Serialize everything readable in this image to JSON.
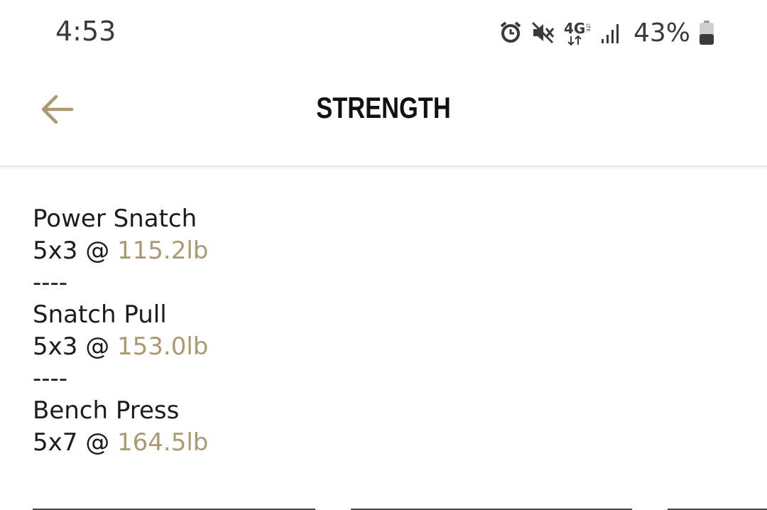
{
  "status_bar": {
    "time": "4:53",
    "battery_percent": "43%",
    "icons": [
      "alarm-icon",
      "mute-icon",
      "4g-lte-icon",
      "signal-icon",
      "battery-icon"
    ]
  },
  "app_bar": {
    "title": "STRENGTH",
    "back_icon": "arrow-left-icon"
  },
  "colors": {
    "accent": "#ab9971",
    "text": "#1c1c1c"
  },
  "workout": {
    "exercises": [
      {
        "name": "Power Snatch",
        "scheme": "5x3 @ ",
        "weight": "115.2lb"
      },
      {
        "name": "Snatch Pull",
        "scheme": "5x3 @ ",
        "weight": "153.0lb"
      },
      {
        "name": "Bench Press",
        "scheme": "5x7 @ ",
        "weight": "164.5lb"
      }
    ],
    "separator": "----"
  }
}
